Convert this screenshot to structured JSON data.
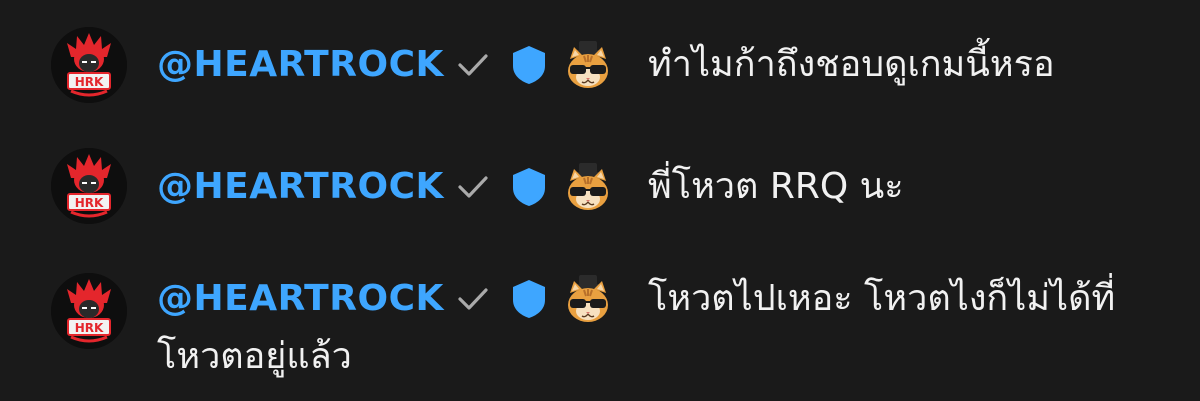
{
  "messages": [
    {
      "author": "@HEARTROCK",
      "text": "ทำไมก้าถึงชอบดูเกมนี้หรอ",
      "continuation": ""
    },
    {
      "author": "@HEARTROCK",
      "text": "พี่โหวต RRQ นะ",
      "continuation": ""
    },
    {
      "author": "@HEARTROCK",
      "text": "โหวตไปเหอะ โหวตไงก็ไม่ได้ที่",
      "continuation": "โหวตอยู่แล้ว"
    }
  ],
  "avatar_text": "HRK",
  "icons": {
    "verified": "checkmark-icon",
    "moderator": "shield-icon",
    "member_emote": "cat-sunglasses-emote-icon"
  },
  "colors": {
    "background": "#1a1a1a",
    "author": "#3ea6ff",
    "message": "#f1f1f1",
    "check": "#aaaaaa",
    "shield": "#3ea6ff",
    "avatar_accent": "#e4262c"
  }
}
